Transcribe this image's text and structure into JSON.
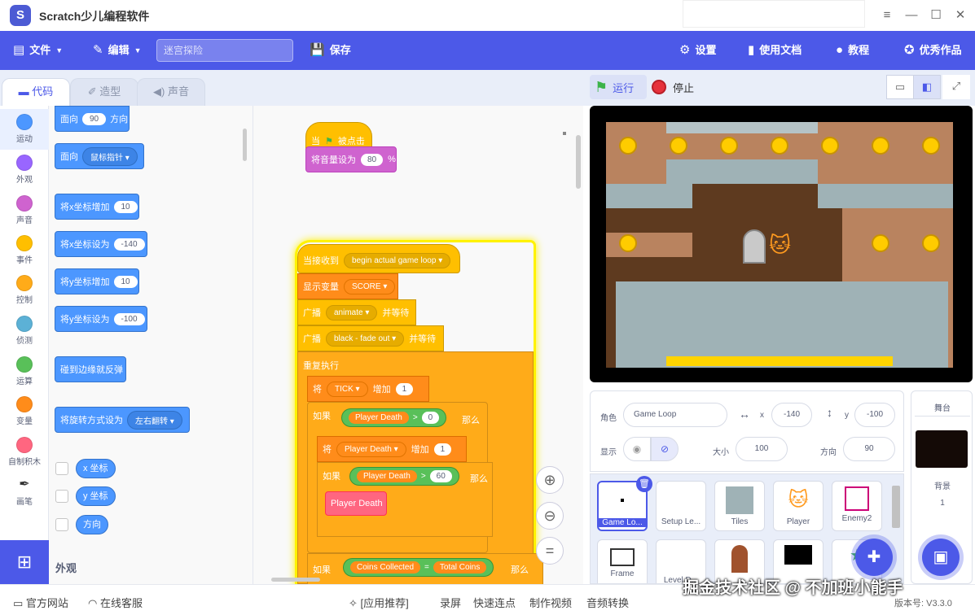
{
  "app": {
    "title": "Scratch少儿编程软件",
    "logo": "S"
  },
  "window_controls": {
    "settings_icon": "≡",
    "min": "—",
    "max": "☐",
    "close": "✕"
  },
  "menu": {
    "file": "文件",
    "edit": "编辑",
    "project_name": "迷宫探险",
    "save": "保存",
    "settings": "设置",
    "docs": "使用文档",
    "tutorial": "教程",
    "showcase": "优秀作品"
  },
  "tabs": {
    "code": "代码",
    "costumes": "造型",
    "sounds": "声音"
  },
  "categories": [
    {
      "label": "运动",
      "color": "#4c97ff"
    },
    {
      "label": "外观",
      "color": "#9966ff"
    },
    {
      "label": "声音",
      "color": "#cf63cf"
    },
    {
      "label": "事件",
      "color": "#ffbf00"
    },
    {
      "label": "控制",
      "color": "#ffab19"
    },
    {
      "label": "侦测",
      "color": "#5cb1d6"
    },
    {
      "label": "运算",
      "color": "#59c059"
    },
    {
      "label": "变量",
      "color": "#ff8c1a"
    },
    {
      "label": "自制积木",
      "color": "#ff6680"
    },
    {
      "label": "画笔",
      "color": "#0fbd8c"
    }
  ],
  "palette": {
    "face_dir": {
      "label1": "面向",
      "value": "90",
      "label2": "方向"
    },
    "face_toward": {
      "label": "面向",
      "dropdown": "鼠标指针"
    },
    "change_x": {
      "label": "将x坐标增加",
      "value": "10"
    },
    "set_x": {
      "label": "将x坐标设为",
      "value": "-140"
    },
    "change_y": {
      "label": "将y坐标增加",
      "value": "10"
    },
    "set_y": {
      "label": "将y坐标设为",
      "value": "-100"
    },
    "bounce": {
      "label": "碰到边缘就反弹"
    },
    "rotation": {
      "label": "将旋转方式设为",
      "dropdown": "左右翻转"
    },
    "reporters": [
      "x 坐标",
      "y 坐标",
      "方向"
    ],
    "section_title": "外观"
  },
  "script1": {
    "when": "当",
    "clicked": "被点击",
    "set_volume": "将音量设为",
    "volume": "80",
    "pct": "%"
  },
  "script2": {
    "receive": "当接收到",
    "msg": "begin actual game loop",
    "show_var": "显示变量",
    "score": "SCORE",
    "broadcast": "广播",
    "b1": "animate",
    "wait": "并等待",
    "b2": "black - fade out",
    "forever": "重复执行",
    "set": "将",
    "tick": "TICK",
    "inc": "增加",
    "one": "1",
    "if": "如果",
    "then": "那么",
    "gt": ">",
    "pdeath": "Player Death",
    "zero": "0",
    "sixty": "60",
    "eq": "=",
    "coins_collected": "Coins Collected",
    "total_coins": "Total Coins"
  },
  "stage_header": {
    "run": "运行",
    "stop": "停止"
  },
  "sprite_info": {
    "sprite_label": "角色",
    "sprite_name": "Game Loop",
    "x_label": "x",
    "x_value": "-140",
    "y_label": "y",
    "y_value": "-100",
    "show_label": "显示",
    "size_label": "大小",
    "size_value": "100",
    "dir_label": "方向",
    "dir_value": "90"
  },
  "sprites": [
    "Game Lo...",
    "Setup Le...",
    "Tiles",
    "Player",
    "Enemy2",
    "Frame",
    "Level D...",
    "",
    "",
    ""
  ],
  "stage_pane": {
    "title": "舞台",
    "backdrops_label": "背景",
    "backdrops_count": "1"
  },
  "footer": {
    "website": "官方网站",
    "support": "在线客服",
    "apps": "[应用推荐]",
    "record": "录屏",
    "clicker": "快速连点",
    "video": "制作视频",
    "audio": "音频转换",
    "version": "版本号: V3.3.0"
  },
  "watermark": "掘金技术社区 @ 不加班小能手"
}
